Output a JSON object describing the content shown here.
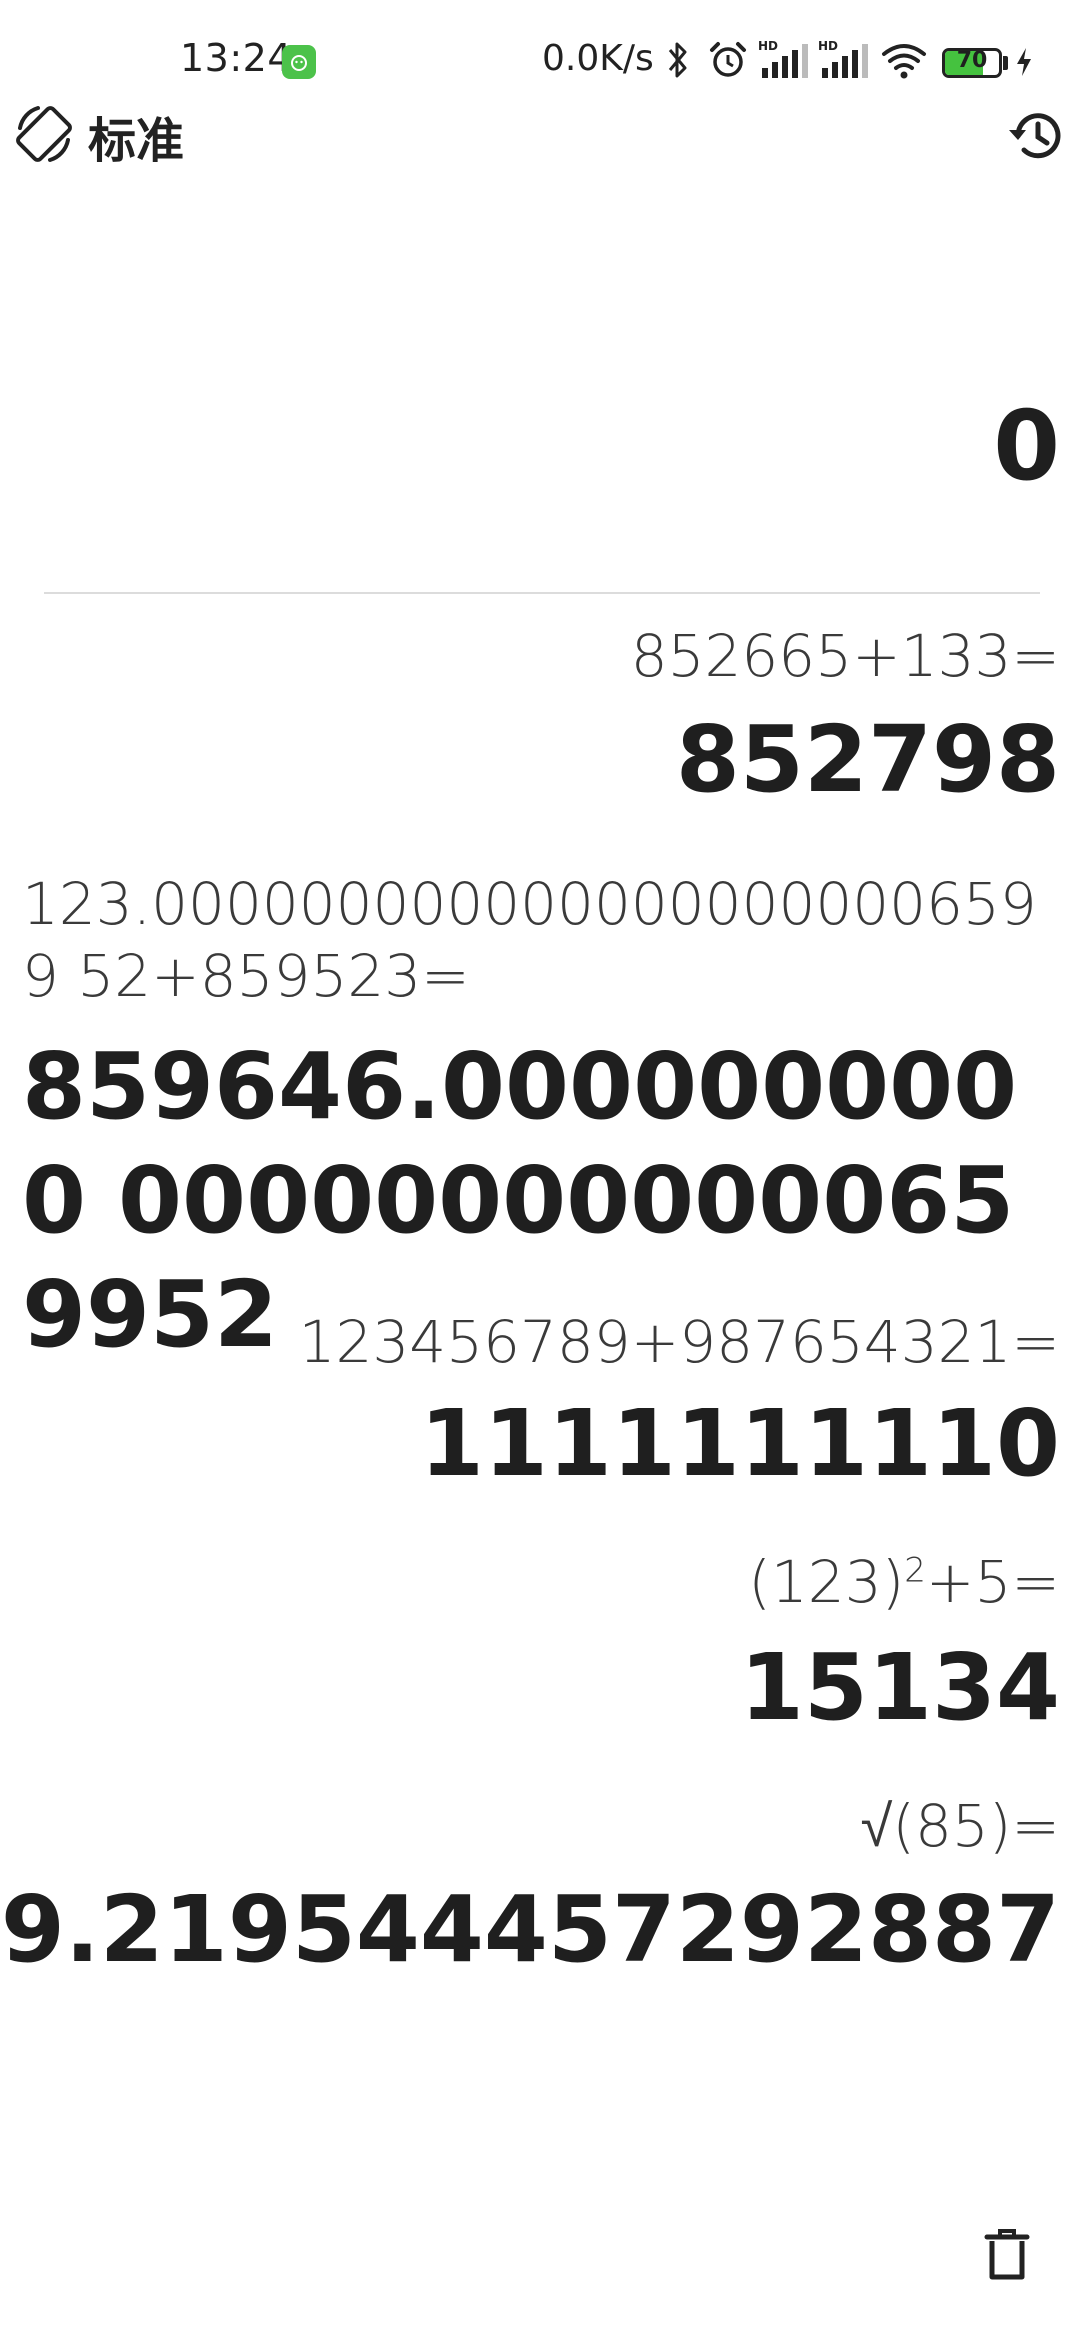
{
  "status_bar": {
    "time": "13:24",
    "net_speed": "0.0K/s",
    "battery_level": "70",
    "battery_fraction": 0.7,
    "icons": [
      "notification-app-icon",
      "bluetooth-icon",
      "alarm-icon",
      "hd-signal-icon",
      "hd-signal-icon",
      "wifi-icon",
      "battery-icon",
      "charging-icon"
    ]
  },
  "app_bar": {
    "mode_label": "标准",
    "mode_icon": "rotate-screen-icon",
    "history_icon": "history-icon"
  },
  "display": {
    "current_value": "0"
  },
  "history": [
    {
      "expression": "852665+133=",
      "result": "852798"
    },
    {
      "expression": "123.0000000000000000000006599 52+859523=",
      "result": "859646.0000000000 000000000000659952"
    },
    {
      "expression": "123456789+987654321=",
      "result": "1111111110"
    },
    {
      "expression_base": "(123)",
      "expression_exp": "2",
      "expression_tail": "+5=",
      "result": "15134"
    },
    {
      "expression": "√(85)=",
      "result": "9.219544457292887"
    }
  ],
  "footer": {
    "delete_icon": "trash-icon"
  },
  "colors": {
    "text": "#1f1f1f",
    "expression_text": "#3a3a3a",
    "divider": "#dcdcdc",
    "battery_green": "#45c23f",
    "badge_green": "#4cc24a"
  }
}
